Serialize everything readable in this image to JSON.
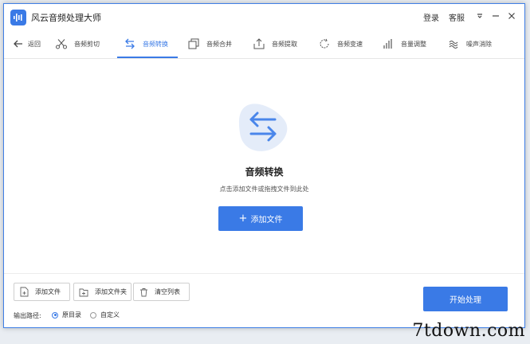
{
  "app": {
    "title": "风云音频处理大师"
  },
  "titlebar": {
    "login": "登录",
    "service": "客服"
  },
  "toolbar": {
    "back": "返回",
    "items": [
      {
        "label": "音频剪切",
        "icon": "scissors-icon"
      },
      {
        "label": "音频转换",
        "icon": "convert-arrows-icon",
        "active": true
      },
      {
        "label": "音频合并",
        "icon": "merge-icon"
      },
      {
        "label": "音频提取",
        "icon": "extract-icon"
      },
      {
        "label": "音频变速",
        "icon": "speed-icon"
      },
      {
        "label": "音量调整",
        "icon": "volume-bars-icon"
      },
      {
        "label": "噪声消除",
        "icon": "noise-wave-icon"
      }
    ]
  },
  "main": {
    "title": "音频转换",
    "subtitle": "点击添加文件或拖拽文件到此处",
    "add_button": "添加文件"
  },
  "bottom": {
    "add_file": "添加文件",
    "add_folder": "添加文件夹",
    "clear_list": "清空列表",
    "output_label": "输出路径:",
    "option_original": "原目录",
    "option_custom": "自定义",
    "selected_option": "原目录",
    "start": "开始处理"
  },
  "watermark": "7tdown.com",
  "colors": {
    "accent": "#3a7ae6",
    "hero_bg": "#e4ecf9"
  }
}
